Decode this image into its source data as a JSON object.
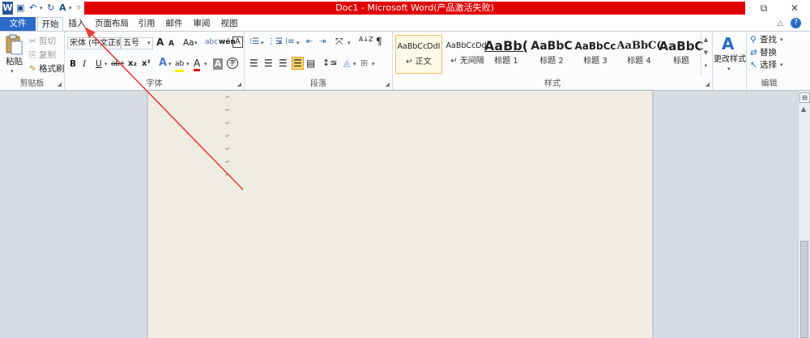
{
  "titlebar": {
    "title": "Doc1 - Microsoft Word(产品激活失败)",
    "qat": {
      "word": "W",
      "save": "▣",
      "undo": "↶",
      "redo": "↻",
      "format": "A"
    },
    "restore": "⧉",
    "close": "✕"
  },
  "tabs": [
    {
      "label": "文件"
    },
    {
      "label": "开始"
    },
    {
      "label": "插入"
    },
    {
      "label": "页面布局"
    },
    {
      "label": "引用"
    },
    {
      "label": "邮件"
    },
    {
      "label": "审阅"
    },
    {
      "label": "视图"
    }
  ],
  "tab_right": {
    "help": "?",
    "collapse": "△"
  },
  "clipboard": {
    "paste": "粘贴",
    "cut": "剪切",
    "copy": "复制",
    "format_painter": "格式刷",
    "label": "剪贴板"
  },
  "font": {
    "font_name": "宋体 (中文正文",
    "font_size": "五号",
    "grow": "A",
    "shrink": "A",
    "case": "Aa",
    "clear": "abc",
    "phonetic": "wén",
    "border_char": "A",
    "bold": "B",
    "italic": "I",
    "underline": "U",
    "strike": "abc",
    "subscript": "x₂",
    "superscript": "x²",
    "effects": "A",
    "highlight": "ab",
    "font_color": "A",
    "shading": "A",
    "enclose": "字",
    "label": "字体"
  },
  "paragraph": {
    "label": "段落",
    "sort": "A↓Z",
    "marks": "¶"
  },
  "styles": {
    "label": "样式",
    "items": [
      {
        "sample": "AaBbCcDdI",
        "name": "↵ 正文"
      },
      {
        "sample": "AaBbCcDdI",
        "name": "↵ 无间隔"
      },
      {
        "sample": "AaBb(",
        "name": "标题 1"
      },
      {
        "sample": "AaBbC",
        "name": "标题 2"
      },
      {
        "sample": "AaBbCc",
        "name": "标题 3"
      },
      {
        "sample": "AaBbC(",
        "name": "标题 4"
      },
      {
        "sample": "AaBbC",
        "name": "标题"
      }
    ],
    "change_styles": "更改样式"
  },
  "editing": {
    "find": "查找",
    "replace": "替换",
    "select": "选择",
    "label": "编辑"
  },
  "document": {
    "para_mark": "↵"
  },
  "colors": {
    "title_red": "#e00000",
    "file_tab": "#2a6bc7",
    "page_bg": "#efede2",
    "arrow": "#e8403a"
  }
}
